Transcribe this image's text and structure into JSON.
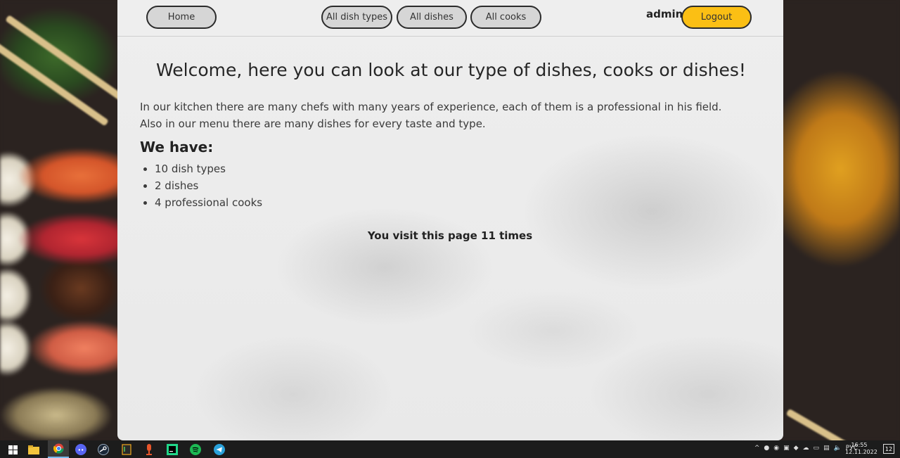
{
  "nav": {
    "home_label": "Home",
    "dish_types_label": "All dish types",
    "dishes_label": "All dishes",
    "cooks_label": "All cooks",
    "username": "admin",
    "logout_label": "Logout"
  },
  "main": {
    "title": "Welcome, here you can look at our type of dishes, cooks or dishes!",
    "intro": "In our kitchen there are many chefs with many years of experience, each of them is a professional in his field. Also in our menu there are many dishes for every taste and type.",
    "have_heading": "We have:",
    "stats": [
      "10 dish types",
      "2 dishes",
      "4 professional cooks"
    ],
    "visits": "You visit this page 11 times"
  },
  "taskbar": {
    "language": "РУС",
    "time": "16:55",
    "date": "12.11.2022",
    "notifications": "12"
  },
  "colors": {
    "logout_bg": "#fbbf14",
    "nav_btn_bg": "#d6d6d6",
    "taskbar_bg": "#1c1c1c"
  }
}
